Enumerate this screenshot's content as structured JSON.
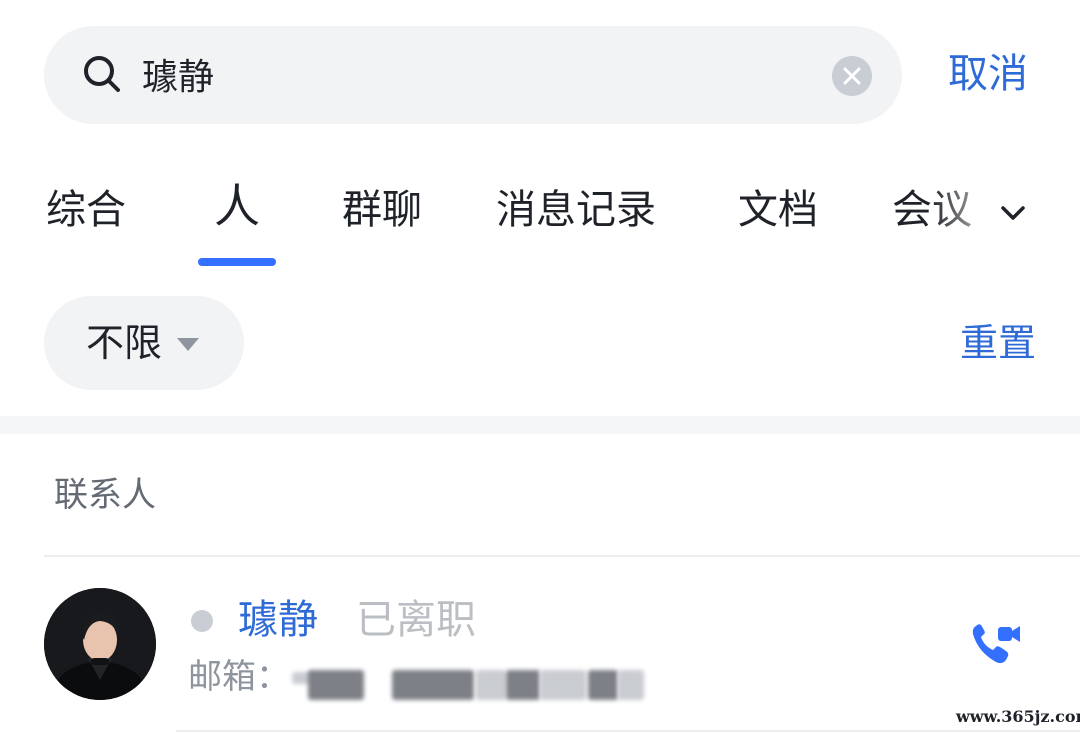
{
  "search": {
    "query": "璩静",
    "cancel_label": "取消"
  },
  "tabs": [
    {
      "label": "综合",
      "active": false
    },
    {
      "label": "人",
      "active": true
    },
    {
      "label": "群聊",
      "active": false
    },
    {
      "label": "消息记录",
      "active": false
    },
    {
      "label": "文档",
      "active": false
    },
    {
      "label": "会议",
      "active": false
    }
  ],
  "filter": {
    "selected": "不限",
    "reset_label": "重置"
  },
  "section": {
    "title": "联系人"
  },
  "contact": {
    "name": "璩静",
    "status": "已离职",
    "email_label": "邮箱："
  },
  "watermark": "www.365jz.com",
  "colors": {
    "accent": "#3370ff",
    "link": "#2f6bd7",
    "status_offline": "#c9cdd4"
  },
  "icons": [
    "search-icon",
    "clear-icon",
    "chevron-down-icon",
    "caret-down-icon",
    "video-call-icon"
  ]
}
